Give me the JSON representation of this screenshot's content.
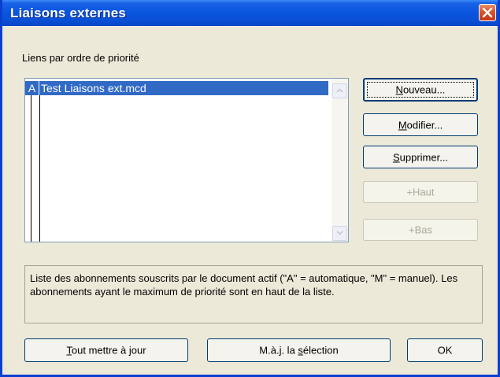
{
  "window": {
    "title": "Liaisons externes"
  },
  "list": {
    "label": "Liens par ordre de priorité",
    "rows": [
      {
        "mode": "A",
        "name": "Test Liaisons ext.mcd",
        "selected": true
      }
    ]
  },
  "buttons": {
    "nouveau": {
      "accel": "N",
      "rest": "ouveau..."
    },
    "modifier": {
      "accel": "M",
      "rest": "odifier..."
    },
    "supprimer": {
      "accel": "S",
      "rest": "upprimer..."
    },
    "haut": "+Haut",
    "bas": "+Bas",
    "tout": {
      "accel": "T",
      "rest": "out mettre à jour"
    },
    "maj": {
      "pre": "M.à.j. la ",
      "accel": "s",
      "rest": "élection"
    },
    "ok": "OK"
  },
  "description": "Liste des abonnements souscrits par le document actif (\"A\" = automatique, \"M\" = manuel). Les abonnements ayant le maximum de priorité sont en haut de la liste.",
  "colors": {
    "titlebar": "#0a4fd4",
    "selection": "#316ac5",
    "face": "#ece9d8"
  }
}
